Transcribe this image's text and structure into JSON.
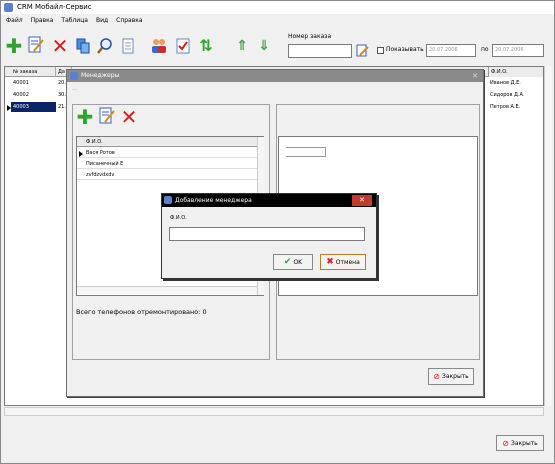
{
  "app": {
    "title": "CRM Мобайл-Сервис",
    "menu": [
      "Файл",
      "Правка",
      "Таблица",
      "Вид",
      "Справка"
    ],
    "order_number_label": "Номер заказа",
    "show_from_label": "Показывать с",
    "date_from": "20.07.2006",
    "date_to_label": "по",
    "date_to": "20.07.2006",
    "columns": [
      "№ заказа",
      "Да",
      "Ф.И.О."
    ],
    "orders": [
      {
        "number": "40001",
        "date": "20.0",
        "fio": "Иванов Д.Е."
      },
      {
        "number": "40002",
        "date": "30.0",
        "fio": "Сидоров Д.А."
      },
      {
        "number": "40003",
        "date": "21.0",
        "fio": "Петров А.Е."
      }
    ],
    "close_button": "Закрыть"
  },
  "managers": {
    "title": "Менеджеры",
    "subtitle": "...",
    "list_header": "Ф.И.О.",
    "items": [
      "Вася Ротов",
      "Писанечный Е",
      "zvfdzvdxdv"
    ],
    "status": "Всего телефонов отремонтировано: 0",
    "close_button": "Закрыть"
  },
  "dialog": {
    "title": "Добавление менеджера",
    "field_label": "Ф.И.О.",
    "field_value": "",
    "ok_button": "OK",
    "cancel_button": "Отмена"
  },
  "colors": {
    "selection": "#0a246a",
    "dialog_title": "#000000",
    "close_red": "#c43a2e",
    "add_green": "#2fa52f",
    "delete_red": "#d32020"
  },
  "icons": {
    "toolbar": [
      "add-icon",
      "edit-icon",
      "delete-icon",
      "copy-icon",
      "find-icon",
      "document-icon",
      "users-icon",
      "checklist-icon",
      "sort-icon",
      "up-icon",
      "down-icon"
    ],
    "managers_toolbar": [
      "add-icon",
      "edit-icon",
      "delete-icon"
    ]
  }
}
